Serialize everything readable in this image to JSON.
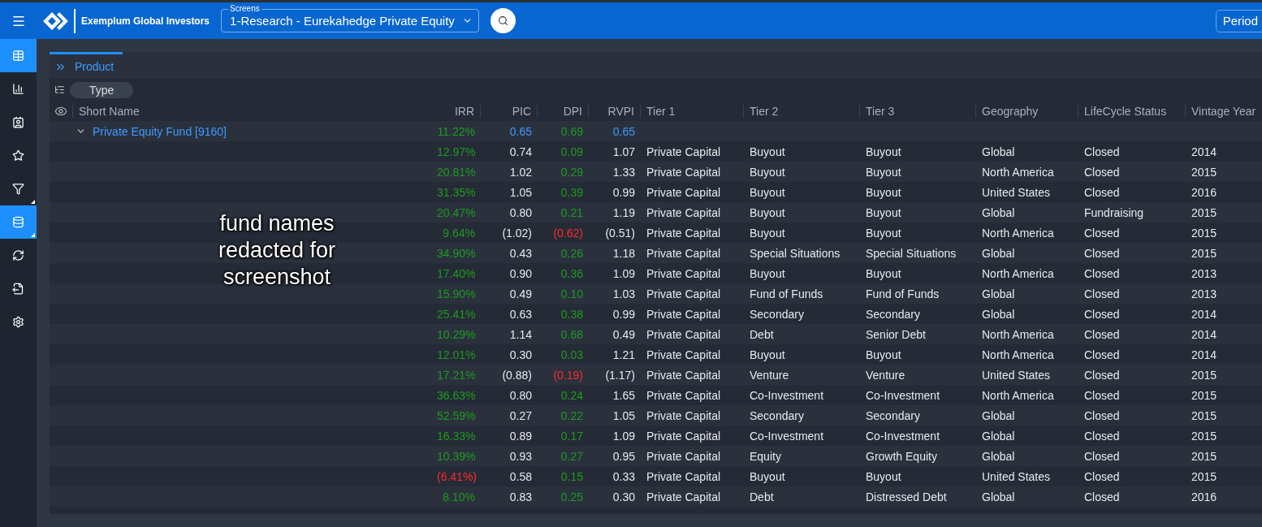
{
  "topbar": {
    "brand": "Exemplum Global Investors",
    "screen_select": {
      "label": "Screens",
      "value": "1-Research - Eurekahedge Private Equity"
    },
    "period_button": "Period"
  },
  "sidebar": {
    "items": [
      {
        "selected": true,
        "has_submenu": false
      },
      {
        "selected": false,
        "has_submenu": false
      },
      {
        "selected": false,
        "has_submenu": false
      },
      {
        "selected": false,
        "has_submenu": false
      },
      {
        "selected": false,
        "has_submenu": true
      },
      {
        "selected": true,
        "has_submenu": true
      },
      {
        "selected": false,
        "has_submenu": false
      },
      {
        "selected": false,
        "has_submenu": false
      },
      {
        "selected": false,
        "has_submenu": false
      }
    ]
  },
  "panel_tab": {
    "label": "Product",
    "selected": true
  },
  "group_chip": "Type",
  "table": {
    "columns": [
      {
        "label": "Short Name",
        "kind": "name"
      },
      {
        "label": "IRR",
        "kind": "gain"
      },
      {
        "label": "PIC",
        "kind": "number"
      },
      {
        "label": "DPI",
        "kind": "gain"
      },
      {
        "label": "RVPI",
        "kind": "number"
      },
      {
        "label": "Tier 1",
        "kind": "text"
      },
      {
        "label": "Tier 2",
        "kind": "text"
      },
      {
        "label": "Tier 3",
        "kind": "text"
      },
      {
        "label": "Geography",
        "kind": "text"
      },
      {
        "label": "LifeCycle Status",
        "kind": "text"
      },
      {
        "label": "Vintage Year",
        "kind": "text"
      }
    ],
    "group": {
      "label": "Private Equity Fund [9160]",
      "expanded": true,
      "irr": "11.22%",
      "pic": "0.65",
      "dpi": "0.69",
      "rvpi": "0.65"
    },
    "rows": [
      {
        "cells": [
          "",
          "12.97%",
          "0.74",
          "0.09",
          "1.07",
          "Private Capital",
          "Buyout",
          "Buyout",
          "Global",
          "Closed",
          "2014"
        ],
        "irr_negative": false,
        "dpi_negative": false
      },
      {
        "cells": [
          "",
          "20.81%",
          "1.02",
          "0.29",
          "1.33",
          "Private Capital",
          "Buyout",
          "Buyout",
          "North America",
          "Closed",
          "2015"
        ],
        "irr_negative": false,
        "dpi_negative": false
      },
      {
        "cells": [
          "",
          "31.35%",
          "1.05",
          "0.39",
          "0.99",
          "Private Capital",
          "Buyout",
          "Buyout",
          "United States",
          "Closed",
          "2016"
        ],
        "irr_negative": false,
        "dpi_negative": false
      },
      {
        "cells": [
          "",
          "20.47%",
          "0.80",
          "0.21",
          "1.19",
          "Private Capital",
          "Buyout",
          "Buyout",
          "Global",
          "Fundraising",
          "2015"
        ],
        "irr_negative": false,
        "dpi_negative": false
      },
      {
        "cells": [
          "",
          "9.64%",
          "(1.02)",
          "(0.62)",
          "(0.51)",
          "Private Capital",
          "Buyout",
          "Buyout",
          "North America",
          "Closed",
          "2015"
        ],
        "irr_negative": false,
        "dpi_negative": true
      },
      {
        "cells": [
          "",
          "34.90%",
          "0.43",
          "0.26",
          "1.18",
          "Private Capital",
          "Special Situations",
          "Special Situations",
          "Global",
          "Closed",
          "2015"
        ],
        "irr_negative": false,
        "dpi_negative": false
      },
      {
        "cells": [
          "",
          "17.40%",
          "0.90",
          "0.36",
          "1.09",
          "Private Capital",
          "Buyout",
          "Buyout",
          "North America",
          "Closed",
          "2013"
        ],
        "irr_negative": false,
        "dpi_negative": false
      },
      {
        "cells": [
          "",
          "15.90%",
          "0.49",
          "0.10",
          "1.03",
          "Private Capital",
          "Fund of Funds",
          "Fund of Funds",
          "Global",
          "Closed",
          "2013"
        ],
        "irr_negative": false,
        "dpi_negative": false
      },
      {
        "cells": [
          "",
          "25.41%",
          "0.63",
          "0.38",
          "0.99",
          "Private Capital",
          "Secondary",
          "Secondary",
          "Global",
          "Closed",
          "2014"
        ],
        "irr_negative": false,
        "dpi_negative": false
      },
      {
        "cells": [
          "",
          "10.29%",
          "1.14",
          "0.68",
          "0.49",
          "Private Capital",
          "Debt",
          "Senior Debt",
          "North America",
          "Closed",
          "2014"
        ],
        "irr_negative": false,
        "dpi_negative": false
      },
      {
        "cells": [
          "",
          "12.01%",
          "0.30",
          "0.03",
          "1.21",
          "Private Capital",
          "Buyout",
          "Buyout",
          "North America",
          "Closed",
          "2014"
        ],
        "irr_negative": false,
        "dpi_negative": false
      },
      {
        "cells": [
          "",
          "17.21%",
          "(0.88)",
          "(0.19)",
          "(1.17)",
          "Private Capital",
          "Venture",
          "Venture",
          "United States",
          "Closed",
          "2015"
        ],
        "irr_negative": false,
        "dpi_negative": true
      },
      {
        "cells": [
          "",
          "36.63%",
          "0.80",
          "0.24",
          "1.65",
          "Private Capital",
          "Co-Investment",
          "Co-Investment",
          "North America",
          "Closed",
          "2015"
        ],
        "irr_negative": false,
        "dpi_negative": false
      },
      {
        "cells": [
          "",
          "52.59%",
          "0.27",
          "0.22",
          "1.05",
          "Private Capital",
          "Secondary",
          "Secondary",
          "Global",
          "Closed",
          "2015"
        ],
        "irr_negative": false,
        "dpi_negative": false
      },
      {
        "cells": [
          "",
          "16.33%",
          "0.89",
          "0.17",
          "1.09",
          "Private Capital",
          "Co-Investment",
          "Co-Investment",
          "Global",
          "Closed",
          "2015"
        ],
        "irr_negative": false,
        "dpi_negative": false
      },
      {
        "cells": [
          "",
          "10.39%",
          "0.93",
          "0.27",
          "0.95",
          "Private Capital",
          "Equity",
          "Growth Equity",
          "Global",
          "Closed",
          "2015"
        ],
        "irr_negative": false,
        "dpi_negative": false
      },
      {
        "cells": [
          "",
          "(6.41%)",
          "0.58",
          "0.15",
          "0.33",
          "Private Capital",
          "Buyout",
          "Buyout",
          "United States",
          "Closed",
          "2015"
        ],
        "irr_negative": true,
        "dpi_negative": false
      },
      {
        "cells": [
          "",
          "8.10%",
          "0.83",
          "0.25",
          "0.30",
          "Private Capital",
          "Debt",
          "Distressed Debt",
          "Global",
          "Closed",
          "2016"
        ],
        "irr_negative": false,
        "dpi_negative": false
      }
    ]
  },
  "redaction_note": "fund names redacted for screenshot"
}
